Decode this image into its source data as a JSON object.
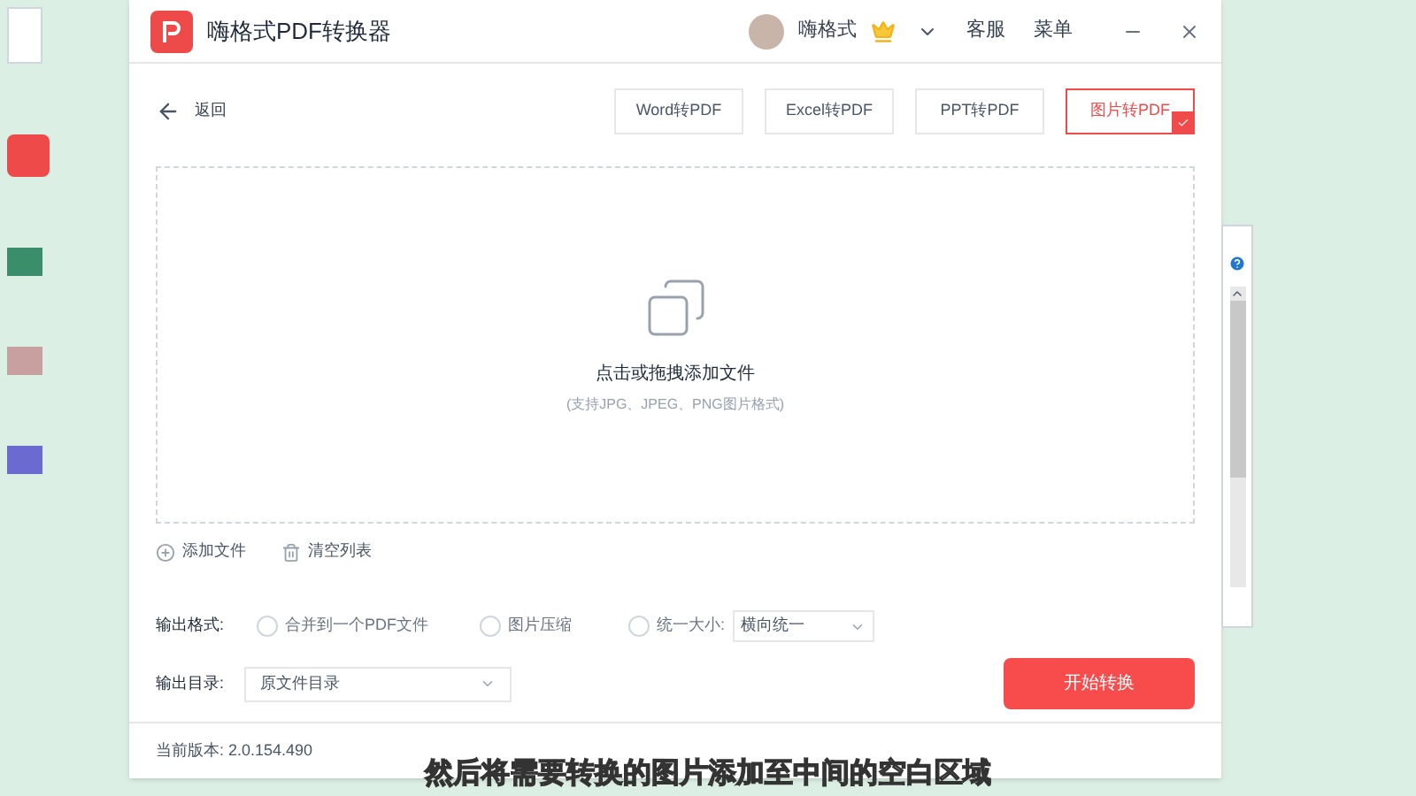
{
  "app": {
    "title": "嗨格式PDF转换器",
    "user": "嗨格式",
    "menu": [
      "客服",
      "菜单"
    ]
  },
  "back": "返回",
  "tabs": [
    {
      "label": "Word转PDF",
      "selected": false
    },
    {
      "label": "Excel转PDF",
      "selected": false
    },
    {
      "label": "PPT转PDF",
      "selected": false
    },
    {
      "label": "图片转PDF",
      "selected": true
    }
  ],
  "drop_zone": {
    "title": "点击或拖拽添加文件",
    "hint": "(支持JPG、JPEG、PNG图片格式)"
  },
  "actions": [
    {
      "label": "添加文件",
      "kind": "add"
    },
    {
      "label": "清空列表",
      "kind": "clear"
    }
  ],
  "output_format": {
    "label": "输出格式:",
    "options": [
      {
        "label": "合并到一个PDF文件",
        "selected": false
      },
      {
        "label": "图片压缩",
        "selected": false
      },
      {
        "label": "统一大小:",
        "selected": false
      }
    ],
    "size_select": "横向统一"
  },
  "output_dir": {
    "label": "输出目录:",
    "value": "原文件目录"
  },
  "start_button": "开始转换",
  "version": "当前版本: 2.0.154.490",
  "caption": "然后将需要转换的图片添加至中间的空白区域"
}
